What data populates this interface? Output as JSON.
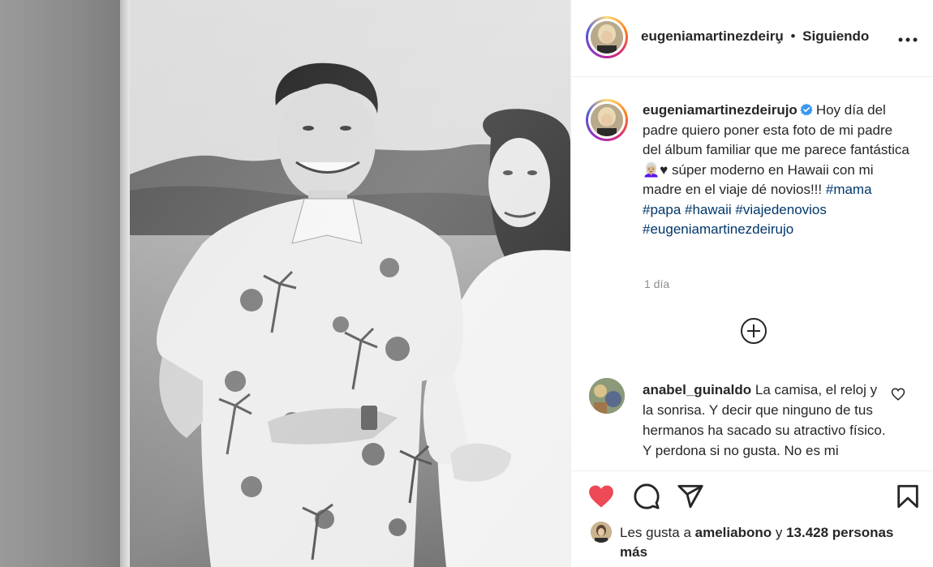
{
  "post": {
    "photo_alt": "black-and-white vintage photo of a man in a Hawaiian shirt and a woman, album page"
  },
  "header": {
    "username": "eugeniamartinezdeiru̧",
    "separator": "•",
    "follow_label": "Siguiendo",
    "more_icon": "more-horizontal-icon"
  },
  "caption": {
    "username": "eugeniamartinezdeirujo",
    "verified_icon": "verified-badge-icon",
    "text_1": "Hoy día del padre quiero poner esta foto de mi padre del álbum familiar que me parece fantástica 👩🏼‍🦳♥ súper moderno en Hawaii con mi madre en el viaje dé novios!!!",
    "hashtags": [
      "#mama",
      "#papa",
      "#hawaii",
      "#viajedenovios",
      "#eugeniamartinezdeirujo"
    ],
    "time": "1 día",
    "load_more_icon": "plus-circle-icon"
  },
  "comment": {
    "username": "anabel_guinaldo",
    "text": "La camisa, el reloj y la sonrisa. Y decir que ninguno de tus hermanos ha sacado su atractivo físico. Y perdona si no gusta. No es mi",
    "like_icon": "heart-outline-icon"
  },
  "actions": {
    "like_icon": "heart-filled-icon",
    "comment_icon": "comment-icon",
    "share_icon": "share-icon",
    "save_icon": "bookmark-icon",
    "like_color": "#ed4956"
  },
  "likes": {
    "prefix": "Les gusta a",
    "user": "ameliabono",
    "middle": "y",
    "count_text": "13.428 personas más"
  }
}
